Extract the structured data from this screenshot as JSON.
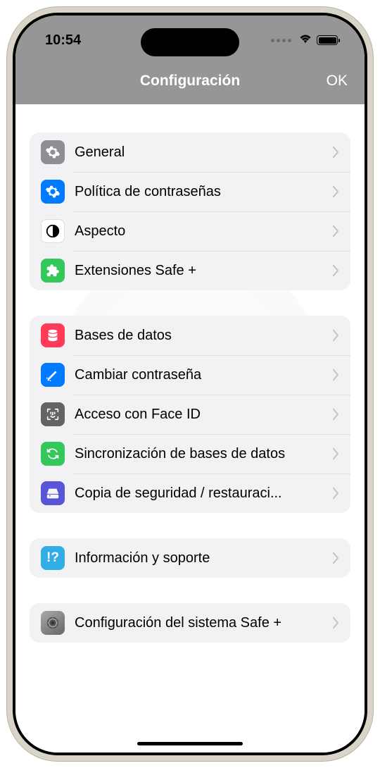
{
  "status": {
    "time": "10:54"
  },
  "nav": {
    "title": "Configuración",
    "ok": "OK"
  },
  "sections": [
    {
      "rows": [
        {
          "id": "general",
          "label": "General",
          "icon": "gear-icon",
          "iconBg": "ic-gray"
        },
        {
          "id": "password-policy",
          "label": "Política de contraseñas",
          "icon": "gear-badge-icon",
          "iconBg": "ic-blue"
        },
        {
          "id": "appearance",
          "label": "Aspecto",
          "icon": "contrast-icon",
          "iconBg": "ic-white"
        },
        {
          "id": "extensions",
          "label": "Extensiones Safe +",
          "icon": "puzzle-icon",
          "iconBg": "ic-green"
        }
      ]
    },
    {
      "rows": [
        {
          "id": "databases",
          "label": "Bases de datos",
          "icon": "database-icon",
          "iconBg": "ic-red"
        },
        {
          "id": "change-password",
          "label": "Cambiar contraseña",
          "icon": "wand-icon",
          "iconBg": "ic-blue"
        },
        {
          "id": "faceid",
          "label": "Acceso con Face ID",
          "icon": "faceid-icon",
          "iconBg": "ic-darkgray"
        },
        {
          "id": "sync",
          "label": "Sincronización de bases de datos",
          "icon": "sync-icon",
          "iconBg": "ic-green"
        },
        {
          "id": "backup",
          "label": "Copia de seguridad / restauraci...",
          "icon": "disk-icon",
          "iconBg": "ic-purple"
        }
      ]
    },
    {
      "rows": [
        {
          "id": "support",
          "label": "Información y soporte",
          "icon": "info-icon",
          "iconBg": "ic-cyan"
        }
      ]
    },
    {
      "rows": [
        {
          "id": "system-config",
          "label": "Configuración del sistema Safe +",
          "icon": "vault-icon",
          "iconBg": "ic-metal"
        }
      ]
    }
  ]
}
